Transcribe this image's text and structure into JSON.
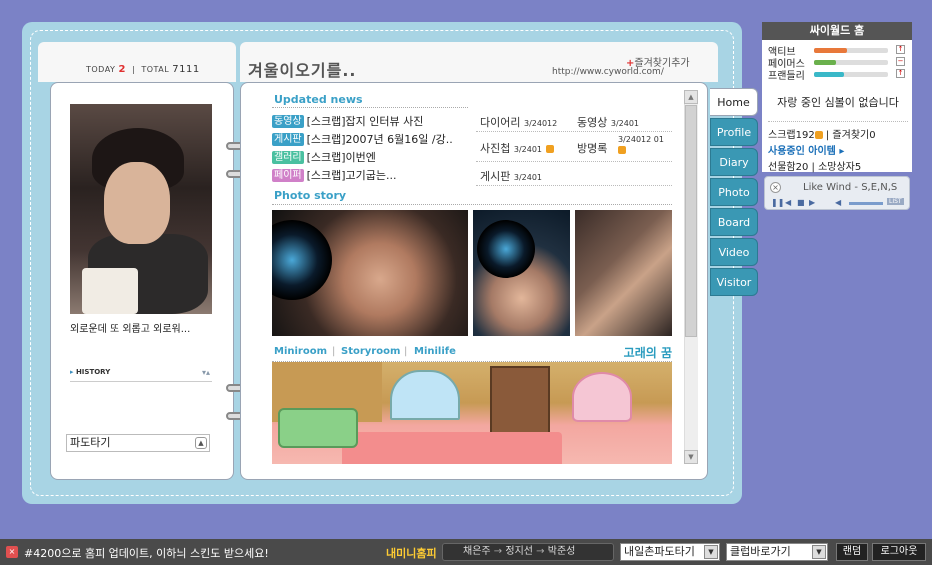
{
  "widget": {
    "title": "싸이월드 홈",
    "bars": [
      {
        "label": "액티브",
        "value": 0.45,
        "color": "#e8783a",
        "indicator": "↑"
      },
      {
        "label": "페이머스",
        "value": 0.3,
        "color": "#6ab04c",
        "indicator": "−"
      },
      {
        "label": "프랜들리",
        "value": 0.4,
        "color": "#3ab8c8",
        "indicator": "↑"
      }
    ],
    "no_bored": "자랑 중인 심볼이 없습니다",
    "scrap": "스크랩192",
    "fav": "즐겨찾기0",
    "item_link": "사용중인 아이템",
    "gift": "선물함20",
    "wish": "소망상자5"
  },
  "bgm": {
    "title": "Like Wind - S,E,N,S",
    "list_label": "LIST"
  },
  "header": {
    "today_label": "TODAY",
    "today_count": "2",
    "total_label": "TOTAL",
    "total_count": "7111",
    "home_title": "겨울이오기를..",
    "fav_link": "즐겨찾기추가",
    "url": "http://www.cyworld.com/"
  },
  "profile": {
    "text": "외로운데 또 외롭고 외로워...",
    "history": "HISTORY",
    "wave": "파도타기"
  },
  "updated_news": {
    "title": "Updated news",
    "items": [
      {
        "badge": "동영상",
        "badge_color": "#3aa0c7",
        "text": "[스크랩]잡지 인터뷰 사진"
      },
      {
        "badge": "게시판",
        "badge_color": "#3aa0c7",
        "text": "[스크랩]2007년 6월16일 /강.."
      },
      {
        "badge": "갤러리",
        "badge_color": "#4ac0a0",
        "text": "[스크랩]이번엔"
      },
      {
        "badge": "페이퍼",
        "badge_color": "#d080c8",
        "text": "[스크랩]고기굽는..."
      }
    ]
  },
  "stats": {
    "diary": {
      "label": "다이어리",
      "count": "3/24012"
    },
    "video": {
      "label": "동영상",
      "count": "3/2401"
    },
    "photo": {
      "label": "사진첩",
      "count": "3/2401"
    },
    "guestbook": {
      "label": "방명록",
      "count": "3/24012 01"
    },
    "board": {
      "label": "게시판",
      "count": "3/2401"
    }
  },
  "photo_story": {
    "title": "Photo story"
  },
  "miniroom": {
    "tabs": [
      "Miniroom",
      "Storyroom",
      "Minilife"
    ],
    "name": "고래의 꿈"
  },
  "tabs": [
    "Home",
    "Profile",
    "Diary",
    "Photo",
    "Board",
    "Video",
    "Visitor"
  ],
  "bottom": {
    "notice": "#4200으로 홈피 업데이트, 이하늬 스킨도 받으세요!",
    "mini": "내미니홈피",
    "friends": [
      "채은주",
      "정지선",
      "박준성"
    ],
    "wave_select": "내일촌파도타기",
    "club_select": "클럽바로가기",
    "random": "랜덤",
    "logout": "로그아웃"
  }
}
